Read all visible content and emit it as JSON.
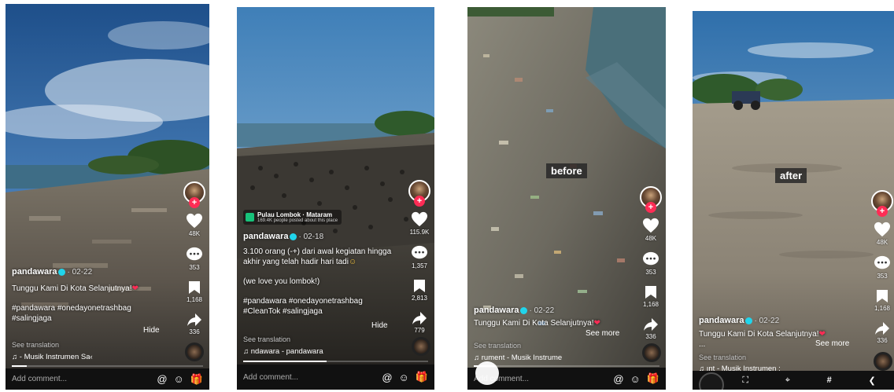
{
  "frame1": {
    "username": "pandawara",
    "date": "· 02-22",
    "caption": "Tunggu Kami Di Kota Selanjutnya!",
    "hashtags_line1": "#pandawara #onedayonetrashbag",
    "hashtags_line2": "#salingjaga",
    "hide": "Hide",
    "see_translation": "See translation",
    "music": "♫ - Musik Instrumen   Sa‹",
    "likes": "48K",
    "comments": "353",
    "saves": "1,168",
    "shares": "336",
    "comment_placeholder": "Add comment..."
  },
  "frame2": {
    "location_title": "Pulau Lombok · Mataram",
    "location_sub": "169.4K people posted about this place",
    "username": "pandawara",
    "date": "· 02-18",
    "caption_line1": "3.100 orang (-+) dari awal kegiatan hingga",
    "caption_line2": "akhir yang telah hadir hari tadi",
    "caption_line3": "(we love you lombok!)",
    "hashtags_line1": "#pandawara #onedayonetrashbag",
    "hashtags_line2": "#CleanTok #salingjaga",
    "hide": "Hide",
    "see_translation": "See translation",
    "music": "♫ ndawara - pandawara",
    "likes": "115.9K",
    "comments": "1,357",
    "saves": "2,813",
    "shares": "779",
    "comment_placeholder": "Add comment..."
  },
  "frame3": {
    "label": "before",
    "username": "pandawara",
    "date": "· 02-22",
    "caption": "Tunggu Kami Di Kota Selanjutnya!",
    "see_more": "See more",
    "see_translation": "See translation",
    "music": "♫ rument - Musik Instrume",
    "likes": "48K",
    "comments": "353",
    "saves": "1,168",
    "shares": "336",
    "comment_placeholder": "Add comment..."
  },
  "frame4": {
    "label": "after",
    "username": "pandawara",
    "date": "· 02-22",
    "caption": "Tunggu Kami Di Kota Selanjutnya!",
    "ellipsis": "...",
    "see_more": "See more",
    "see_translation": "See translation",
    "music": "♫ ınt - Musik Instrumen   :",
    "likes": "48K",
    "comments": "353",
    "saves": "1,168",
    "shares": "336"
  },
  "colors": {
    "accent": "#fe2c55",
    "verified": "#20d5ec",
    "location_pin": "#17c27a"
  }
}
